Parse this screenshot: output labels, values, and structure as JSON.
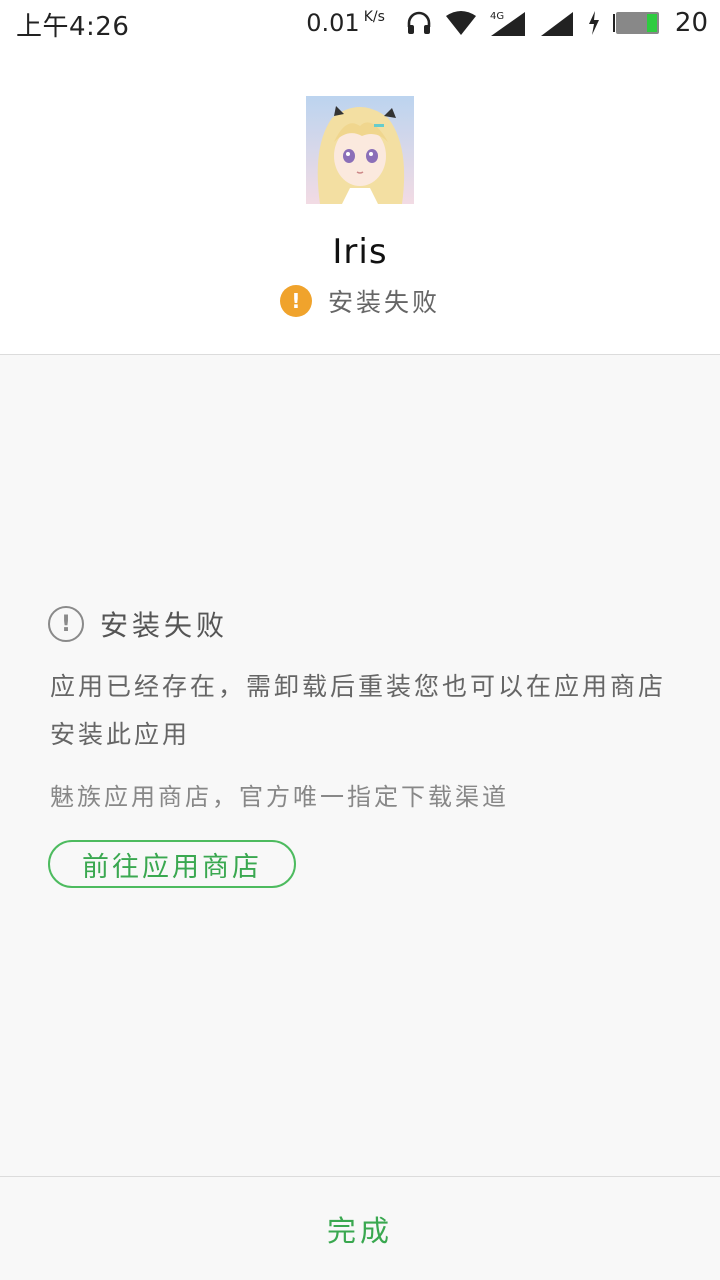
{
  "status_bar": {
    "time": "上午4:26",
    "net_speed": "0.01",
    "net_speed_unit": "K/s",
    "network_type": "4G",
    "battery": "20",
    "icons": [
      "headphones-icon",
      "wifi-icon",
      "signal-4g-icon",
      "signal-icon",
      "charging-icon",
      "battery-icon"
    ]
  },
  "app": {
    "name": "Iris",
    "status": "安装失败",
    "status_color": "#f0a32c"
  },
  "error": {
    "title": "安装失败",
    "description": "应用已经存在，需卸载后重装您也可以在应用商店安装此应用",
    "channel_note": "魅族应用商店，官方唯一指定下载渠道",
    "store_button": "前往应用商店"
  },
  "footer": {
    "done_label": "完成"
  },
  "colors": {
    "accent_green": "#3aa850",
    "warning": "#f0a32c",
    "background": "#f8f8f8"
  }
}
